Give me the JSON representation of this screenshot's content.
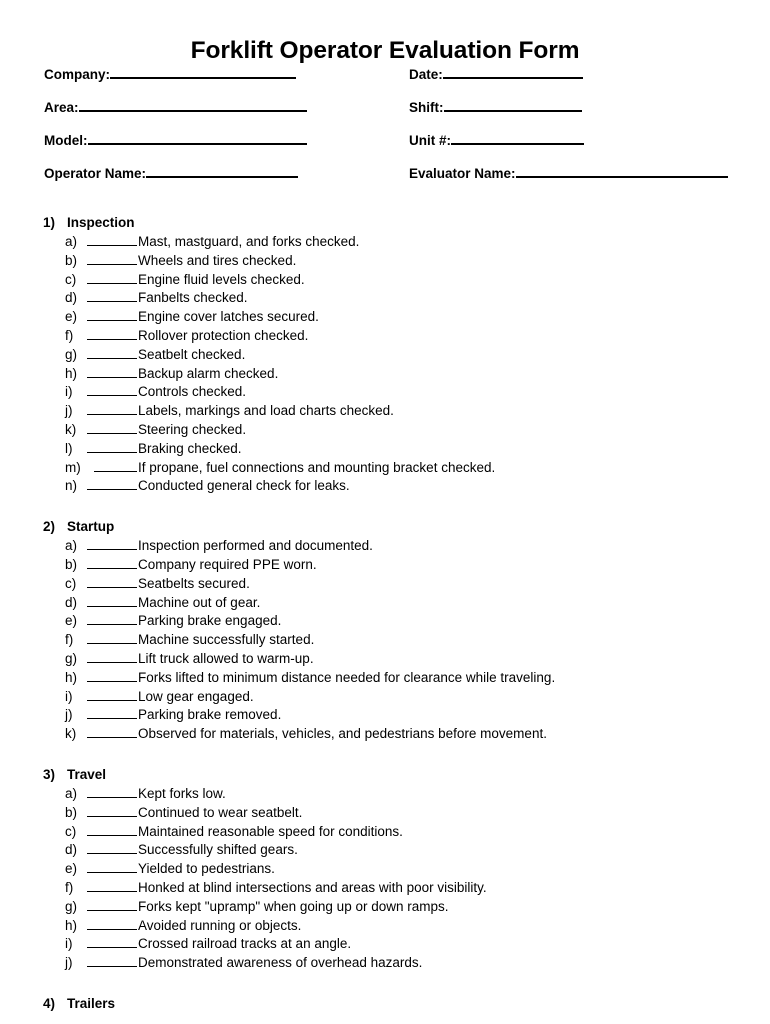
{
  "document": {
    "title": "Forklift Operator Evaluation Form"
  },
  "header_fields": {
    "rows": [
      {
        "left": {
          "label": "Company:",
          "value": "",
          "rule_width": 186
        },
        "right": {
          "label": "Date:",
          "value": "",
          "rule_width": 140
        }
      },
      {
        "left": {
          "label": "Area:",
          "value": "",
          "rule_width": 228
        },
        "right": {
          "label": "Shift:",
          "value": "",
          "rule_width": 138
        }
      },
      {
        "left": {
          "label": "Model:",
          "value": "",
          "rule_width": 219
        },
        "right": {
          "label": "Unit #:",
          "value": "",
          "rule_width": 133
        }
      },
      {
        "left": {
          "label": "Operator Name:",
          "value": "",
          "rule_width": 152
        },
        "right": {
          "label": "Evaluator Name:",
          "value": "",
          "rule_width": 212
        }
      }
    ]
  },
  "sections": [
    {
      "number": "1)",
      "title": "Inspection",
      "items": [
        {
          "marker": "a)",
          "text": "Mast, mastguard, and forks checked."
        },
        {
          "marker": "b)",
          "text": "Wheels and tires checked."
        },
        {
          "marker": "c)",
          "text": "Engine fluid levels checked."
        },
        {
          "marker": "d)",
          "text": "Fanbelts checked."
        },
        {
          "marker": "e)",
          "text": "Engine cover latches secured."
        },
        {
          "marker": "f)",
          "text": "Rollover protection checked."
        },
        {
          "marker": "g)",
          "text": "Seatbelt checked."
        },
        {
          "marker": "h)",
          "text": "Backup alarm checked."
        },
        {
          "marker": "i)",
          "text": "Controls checked."
        },
        {
          "marker": "j)",
          "text": "Labels, markings and load charts checked."
        },
        {
          "marker": "k)",
          "text": "Steering checked."
        },
        {
          "marker": "l)",
          "text": "Braking checked."
        },
        {
          "marker": "m)",
          "text": "If propane, fuel connections and mounting bracket checked.",
          "wide": true
        },
        {
          "marker": "n)",
          "text": "Conducted general check for leaks."
        }
      ]
    },
    {
      "number": "2)",
      "title": "Startup",
      "items": [
        {
          "marker": "a)",
          "text": "Inspection performed and documented."
        },
        {
          "marker": "b)",
          "text": "Company required PPE worn."
        },
        {
          "marker": "c)",
          "text": "Seatbelts secured."
        },
        {
          "marker": "d)",
          "text": "Machine out of gear."
        },
        {
          "marker": "e)",
          "text": "Parking brake engaged."
        },
        {
          "marker": "f)",
          "text": "Machine successfully started."
        },
        {
          "marker": "g)",
          "text": "Lift truck allowed to warm-up."
        },
        {
          "marker": "h)",
          "text": "Forks lifted to minimum distance needed for clearance while traveling."
        },
        {
          "marker": "i)",
          "text": "Low gear engaged."
        },
        {
          "marker": "j)",
          "text": "Parking brake removed."
        },
        {
          "marker": "k)",
          "text": "Observed for materials, vehicles, and pedestrians before movement."
        }
      ]
    },
    {
      "number": "3)",
      "title": "Travel",
      "items": [
        {
          "marker": "a)",
          "text": "Kept forks low."
        },
        {
          "marker": "b)",
          "text": "Continued to wear seatbelt."
        },
        {
          "marker": "c)",
          "text": "Maintained reasonable speed for conditions."
        },
        {
          "marker": "d)",
          "text": "Successfully shifted gears."
        },
        {
          "marker": "e)",
          "text": "Yielded to pedestrians."
        },
        {
          "marker": "f)",
          "text": "Honked at blind intersections and areas with poor visibility."
        },
        {
          "marker": "g)",
          "text": "Forks kept \"upramp\" when going up or down ramps."
        },
        {
          "marker": "h)",
          "text": "Avoided running or objects."
        },
        {
          "marker": "i)",
          "text": "Crossed railroad tracks at an angle."
        },
        {
          "marker": "j)",
          "text": "Demonstrated awareness of overhead hazards."
        }
      ]
    },
    {
      "number": "4)",
      "title": "Trailers",
      "items": []
    }
  ]
}
